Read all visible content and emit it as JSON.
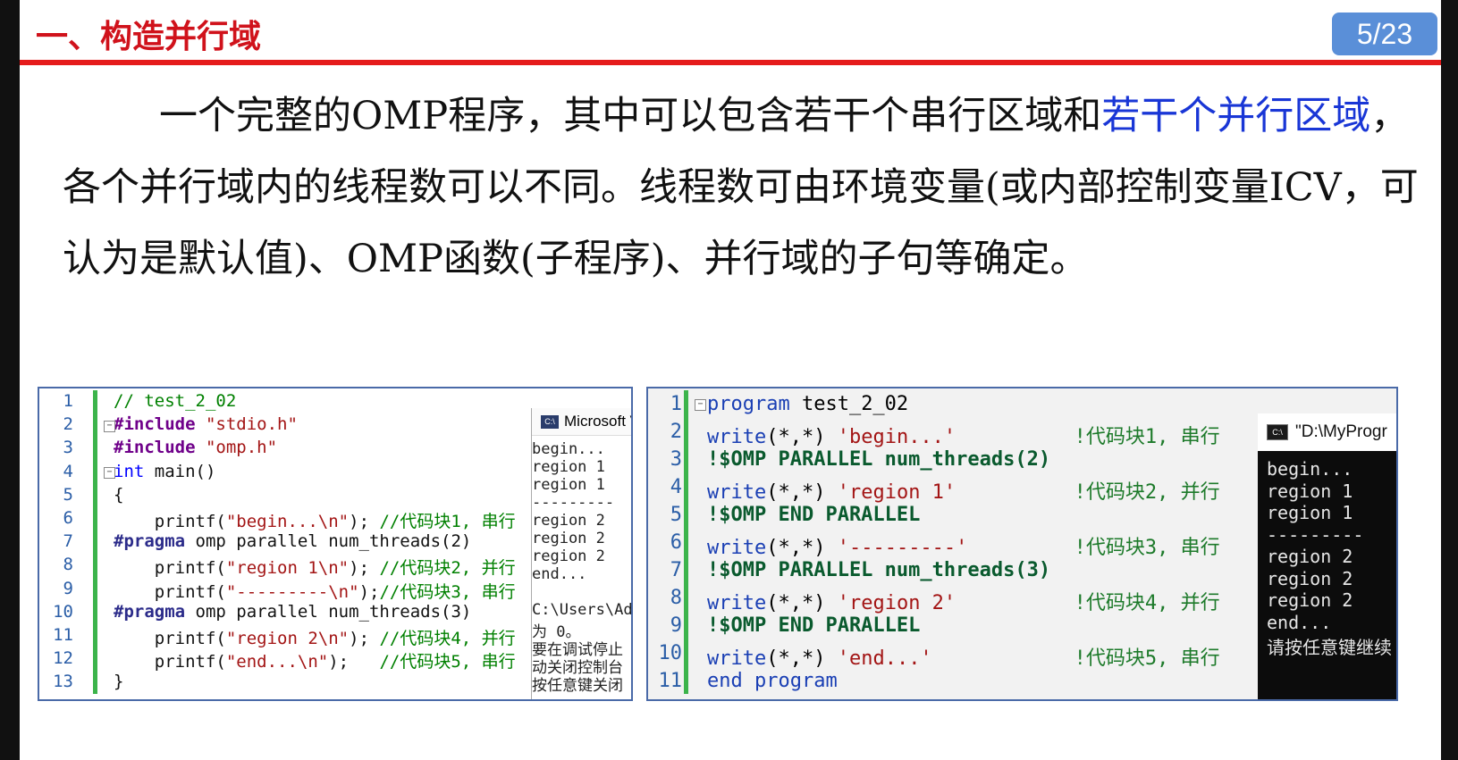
{
  "header": {
    "title": "一、构造并行域",
    "page": "5/23"
  },
  "paragraph": {
    "part1": "一个完整的OMP程序，其中可以包含若干个串行区域和",
    "highlight": "若干个并行区域",
    "part2": "，各个并行域内的线程数可以不同。线程数可由环境变量(或内部控制变量ICV，可认为是默认值)、OMP函数(子程序)、并行域的子句等确定。"
  },
  "c_code": {
    "line_numbers": [
      "1",
      "2",
      "3",
      "4",
      "5",
      "6",
      "7",
      "8",
      "9",
      "10",
      "11",
      "12",
      "13"
    ],
    "lines": [
      {
        "html_parts": [
          [
            "cmt",
            "// test_2_02"
          ]
        ]
      },
      {
        "html_parts": [
          [
            "pre",
            "#include"
          ],
          [
            "plain",
            " "
          ],
          [
            "str",
            "\"stdio.h\""
          ]
        ]
      },
      {
        "html_parts": [
          [
            "pre",
            "#include"
          ],
          [
            "plain",
            " "
          ],
          [
            "str",
            "\"omp.h\""
          ]
        ]
      },
      {
        "html_parts": [
          [
            "kw",
            "int"
          ],
          [
            "plain",
            " main()"
          ]
        ]
      },
      {
        "html_parts": [
          [
            "plain",
            "{"
          ]
        ]
      },
      {
        "html_parts": [
          [
            "plain",
            "    printf("
          ],
          [
            "str",
            "\"begin...\\n\""
          ],
          [
            "plain",
            "); "
          ],
          [
            "cmt",
            "//代码块1, 串行"
          ]
        ]
      },
      {
        "html_parts": [
          [
            "pragma",
            "#pragma"
          ],
          [
            "plain",
            " omp parallel num_threads(2)"
          ]
        ]
      },
      {
        "html_parts": [
          [
            "plain",
            "    printf("
          ],
          [
            "str",
            "\"region 1\\n\""
          ],
          [
            "plain",
            "); "
          ],
          [
            "cmt",
            "//代码块2, 并行"
          ]
        ]
      },
      {
        "html_parts": [
          [
            "plain",
            "    printf("
          ],
          [
            "str",
            "\"---------\\n\""
          ],
          [
            "plain",
            ");"
          ],
          [
            "cmt",
            "//代码块3, 串行"
          ]
        ]
      },
      {
        "html_parts": [
          [
            "pragma",
            "#pragma"
          ],
          [
            "plain",
            " omp parallel num_threads(3)"
          ]
        ]
      },
      {
        "html_parts": [
          [
            "plain",
            "    printf("
          ],
          [
            "str",
            "\"region 2\\n\""
          ],
          [
            "plain",
            "); "
          ],
          [
            "cmt",
            "//代码块4, 并行"
          ]
        ]
      },
      {
        "html_parts": [
          [
            "plain",
            "    printf("
          ],
          [
            "str",
            "\"end...\\n\""
          ],
          [
            "plain",
            ");   "
          ],
          [
            "cmt",
            "//代码块5, 串行"
          ]
        ]
      },
      {
        "html_parts": [
          [
            "plain",
            "}"
          ]
        ]
      }
    ],
    "console_title": "Microsoft V",
    "console_lines": [
      "begin...",
      "region 1",
      "region 1",
      "---------",
      "region 2",
      "region 2",
      "region 2",
      "end...",
      "",
      "C:\\Users\\Adm",
      "为 0。",
      "要在调试停止",
      "动关闭控制台",
      "按任意键关闭"
    ]
  },
  "f_code": {
    "line_numbers": [
      "1",
      "2",
      "3",
      "4",
      "5",
      "6",
      "7",
      "8",
      "9",
      "10",
      "11"
    ],
    "lines": [
      {
        "html_parts": [
          [
            "fkw",
            "program"
          ],
          [
            "plain",
            " test_2_02"
          ]
        ]
      },
      {
        "html_parts": [
          [
            "fkw",
            "write"
          ],
          [
            "plain",
            "(*,*) "
          ],
          [
            "fstr",
            "'begin...'"
          ],
          [
            "plain",
            "          "
          ],
          [
            "fcmt",
            "!代码块1, 串行"
          ]
        ]
      },
      {
        "html_parts": [
          [
            "fomp",
            "!$OMP PARALLEL num_threads(2)"
          ]
        ]
      },
      {
        "html_parts": [
          [
            "fkw",
            "write"
          ],
          [
            "plain",
            "(*,*) "
          ],
          [
            "fstr",
            "'region 1'"
          ],
          [
            "plain",
            "          "
          ],
          [
            "fcmt",
            "!代码块2, 并行"
          ]
        ]
      },
      {
        "html_parts": [
          [
            "fomp",
            "!$OMP END PARALLEL"
          ]
        ]
      },
      {
        "html_parts": [
          [
            "fkw",
            "write"
          ],
          [
            "plain",
            "(*,*) "
          ],
          [
            "fstr",
            "'---------'"
          ],
          [
            "plain",
            "         "
          ],
          [
            "fcmt",
            "!代码块3, 串行"
          ]
        ]
      },
      {
        "html_parts": [
          [
            "fomp",
            "!$OMP PARALLEL num_threads(3)"
          ]
        ]
      },
      {
        "html_parts": [
          [
            "fkw",
            "write"
          ],
          [
            "plain",
            "(*,*) "
          ],
          [
            "fstr",
            "'region 2'"
          ],
          [
            "plain",
            "          "
          ],
          [
            "fcmt",
            "!代码块4, 并行"
          ]
        ]
      },
      {
        "html_parts": [
          [
            "fomp",
            "!$OMP END PARALLEL"
          ]
        ]
      },
      {
        "html_parts": [
          [
            "fkw",
            "write"
          ],
          [
            "plain",
            "(*,*) "
          ],
          [
            "fstr",
            "'end...'"
          ],
          [
            "plain",
            "            "
          ],
          [
            "fcmt",
            "!代码块5, 串行"
          ]
        ]
      },
      {
        "html_parts": [
          [
            "fkw",
            "end program"
          ]
        ]
      }
    ],
    "console_title": "\"D:\\MyProgr",
    "console_lines": [
      "begin...",
      "region 1",
      "region 1",
      "---------",
      "region 2",
      "region 2",
      "region 2",
      "end...",
      "请按任意键继续"
    ]
  }
}
